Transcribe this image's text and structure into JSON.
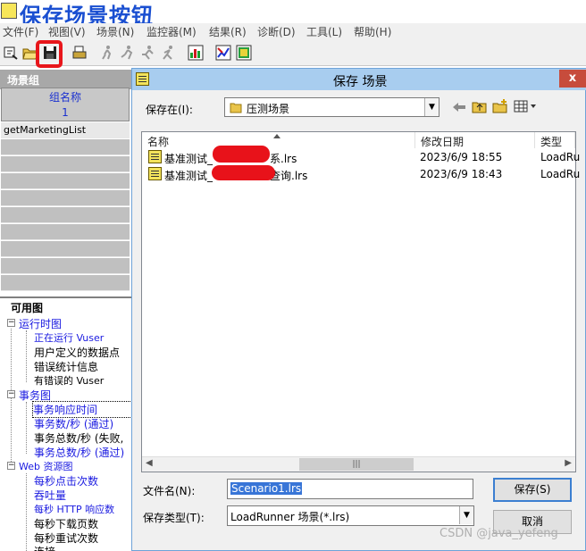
{
  "app": {
    "title": "保存场景按钮"
  },
  "menu": [
    "文件(F)",
    "视图(V)",
    "场景(N)",
    "监控器(M)",
    "结果(R)",
    "诊断(D)",
    "工具(L)",
    "帮助(H)"
  ],
  "toolbar": {
    "icons": [
      "new-scenario-icon",
      "open-icon",
      "save-icon",
      "print-icon",
      "run-icon",
      "stop-icon",
      "pause-icon",
      "step-icon",
      "analysis-icon",
      "graph-icon",
      "chart-icon"
    ],
    "highlight_color": "#e8161b"
  },
  "left_panel": {
    "scenario_group_header": "场景组",
    "group_col_title": "组名称",
    "group_col_num": "1",
    "first_row": "getMarketingList",
    "graphs_header": "可用图",
    "tree": [
      {
        "label": "运行时图",
        "kind": "cat"
      },
      {
        "label": "正在运行 Vuser",
        "kind": "blue"
      },
      {
        "label": "用户定义的数据点",
        "kind": "leaf"
      },
      {
        "label": "错误统计信息",
        "kind": "leaf"
      },
      {
        "label": "有错误的 Vuser",
        "kind": "leaf"
      },
      {
        "label": "事务图",
        "kind": "cat"
      },
      {
        "label": "事务响应时间",
        "kind": "blue"
      },
      {
        "label": "事务数/秒 (通过)",
        "kind": "blue"
      },
      {
        "label": "事务总数/秒 (失败,",
        "kind": "leaf"
      },
      {
        "label": "事务总数/秒 (通过)",
        "kind": "blue"
      },
      {
        "label": "Web 资源图",
        "kind": "cat"
      },
      {
        "label": "每秒点击次数",
        "kind": "blue"
      },
      {
        "label": "吞吐量",
        "kind": "blue"
      },
      {
        "label": "每秒 HTTP 响应数",
        "kind": "blue"
      },
      {
        "label": "每秒下载页数",
        "kind": "leaf"
      },
      {
        "label": "每秒重试次数",
        "kind": "leaf"
      },
      {
        "label": "连接",
        "kind": "leaf"
      }
    ]
  },
  "dialog": {
    "title": "保存 场景",
    "save_in_label": "保存在(I):",
    "save_in_value": "压测场景",
    "columns": [
      "名称",
      "修改日期",
      "类型"
    ],
    "files": [
      {
        "name_prefix": "基准测试_",
        "name_suffix": "系.lrs",
        "date": "2023/6/9 18:55",
        "type": "LoadRu"
      },
      {
        "name_prefix": "基准测试_",
        "name_suffix": "查询.lrs",
        "date": "2023/6/9 18:43",
        "type": "LoadRu"
      }
    ],
    "filename_label": "文件名(N):",
    "filename_value": "Scenario1.lrs",
    "filetype_label": "保存类型(T):",
    "filetype_value": "LoadRunner 场景(*.lrs)",
    "save_button": "保存(S)",
    "cancel_button": "取消",
    "close_glyph": "x"
  },
  "watermark": "CSDN @java_yefeng"
}
